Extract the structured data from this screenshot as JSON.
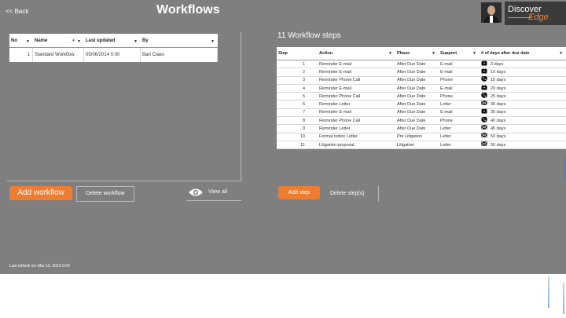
{
  "header": {
    "back_label": "<< Back",
    "title": "Workflows",
    "logo_word1": "Discover",
    "logo_word2": "Edge"
  },
  "workflows": {
    "columns": [
      "No",
      "Name",
      "Last updated",
      "By"
    ],
    "rows": [
      {
        "no": "1",
        "name": "Standard Workflow",
        "updated": "05/06/2014 0:00",
        "by": "Bart Claes"
      }
    ],
    "add_label": "Add workflow",
    "delete_label": "Delete workflow",
    "view_all_label": "View all"
  },
  "steps": {
    "title": "11 Workflow steps",
    "columns": [
      "Step",
      "Action",
      "Phase",
      "Support",
      "# of days after due date"
    ],
    "rows": [
      {
        "step": "1",
        "action": "Reminder E-mail",
        "phase": "After Due Date",
        "support": "E-mail",
        "icon": "briefcase",
        "days": "3 days"
      },
      {
        "step": "2",
        "action": "Reminder E-mail",
        "phase": "After Due Date",
        "support": "E-mail",
        "icon": "briefcase",
        "days": "10 days"
      },
      {
        "step": "3",
        "action": "Reminder Phone Call",
        "phase": "After Due Date",
        "support": "Phone",
        "icon": "phone",
        "days": "15 days"
      },
      {
        "step": "4",
        "action": "Reminder E-mail",
        "phase": "After Due Date",
        "support": "E-mail",
        "icon": "briefcase",
        "days": "20 days"
      },
      {
        "step": "5",
        "action": "Reminder Phone Call",
        "phase": "After Due Date",
        "support": "Phone",
        "icon": "phone",
        "days": "25 days"
      },
      {
        "step": "6",
        "action": "Reminder Letter",
        "phase": "After Due Date",
        "support": "Letter",
        "icon": "envelope",
        "days": "30 days"
      },
      {
        "step": "7",
        "action": "Reminder E-mail",
        "phase": "After Due Date",
        "support": "E-mail",
        "icon": "briefcase",
        "days": "35 days"
      },
      {
        "step": "8",
        "action": "Reminder Phone Call",
        "phase": "After Due Date",
        "support": "Phone",
        "icon": "phone",
        "days": "40 days"
      },
      {
        "step": "9",
        "action": "Reminder Letter",
        "phase": "After Due Date",
        "support": "Letter",
        "icon": "envelope",
        "days": "45 days"
      },
      {
        "step": "10",
        "action": "Formal notice Letter",
        "phase": "Pre Litigation",
        "support": "Letter",
        "icon": "envelope",
        "days": "50 days"
      },
      {
        "step": "11",
        "action": "Litigation proposal",
        "phase": "Litigation",
        "support": "Letter",
        "icon": "envelope",
        "days": "55 days"
      }
    ],
    "add_label": "Add step",
    "delete_label": "Delete step(s)"
  },
  "footer": {
    "last_refresh": "Last refresh on: Mar 13, 2015 0:00"
  },
  "colors": {
    "background": "#7f7f7f",
    "accent": "#ed7d31",
    "filter_icon": "#1a9d2a"
  }
}
